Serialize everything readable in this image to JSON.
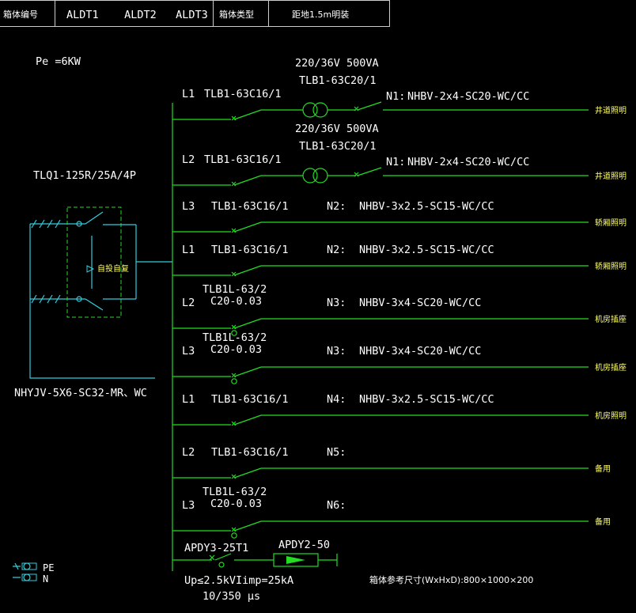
{
  "header": {
    "box_no_label": "箱体编号",
    "box_ids": "ALDT1    ALDT2   ALDT3",
    "box_type_label": "箱体类型",
    "box_type_value": "距地1.5m明装"
  },
  "panel": {
    "power": "Pe =6KW",
    "main_switch": "TLQ1-125R/25A/4P",
    "ats_label": "自投自复",
    "incoming_cable": "NHYJV-5X6-SC32-MR、WC"
  },
  "circuits": [
    {
      "phase": "L1",
      "breaker": "TLB1-63C16/1",
      "breaker2": "",
      "trafo_spec": "220/36V  500VA",
      "trafo_breaker": "TLB1-63C20/1",
      "circuit": "N1:",
      "cable": "NHBV-2x4-SC20-WC/CC",
      "load": "井道照明"
    },
    {
      "phase": "L2",
      "breaker": "TLB1-63C16/1",
      "breaker2": "",
      "trafo_spec": "220/36V  500VA",
      "trafo_breaker": "TLB1-63C20/1",
      "circuit": "N1:",
      "cable": "NHBV-2x4-SC20-WC/CC",
      "load": "井道照明"
    },
    {
      "phase": "L3",
      "breaker": "TLB1-63C16/1",
      "breaker2": "",
      "trafo_spec": "",
      "trafo_breaker": "",
      "circuit": "N2:",
      "cable": "NHBV-3x2.5-SC15-WC/CC",
      "load": "轿厢照明"
    },
    {
      "phase": "L1",
      "breaker": "TLB1-63C16/1",
      "breaker2": "",
      "trafo_spec": "",
      "trafo_breaker": "",
      "circuit": "N2:",
      "cable": "NHBV-3x2.5-SC15-WC/CC",
      "load": "轿厢照明"
    },
    {
      "phase": "L2",
      "breaker": "TLB1L-63/2",
      "breaker2": "C20-0.03",
      "trafo_spec": "",
      "trafo_breaker": "",
      "circuit": "N3:",
      "cable": "NHBV-3x4-SC20-WC/CC",
      "load": "机房插座"
    },
    {
      "phase": "L3",
      "breaker": "TLB1L-63/2",
      "breaker2": "C20-0.03",
      "trafo_spec": "",
      "trafo_breaker": "",
      "circuit": "N3:",
      "cable": "NHBV-3x4-SC20-WC/CC",
      "load": "机房插座"
    },
    {
      "phase": "L1",
      "breaker": "TLB1-63C16/1",
      "breaker2": "",
      "trafo_spec": "",
      "trafo_breaker": "",
      "circuit": "N4:",
      "cable": "NHBV-3x2.5-SC15-WC/CC",
      "load": "机房照明"
    },
    {
      "phase": "L2",
      "breaker": "TLB1-63C16/1",
      "breaker2": "",
      "trafo_spec": "",
      "trafo_breaker": "",
      "circuit": "N5:",
      "cable": "",
      "load": "备用"
    },
    {
      "phase": "L3",
      "breaker": "TLB1L-63/2",
      "breaker2": "C20-0.03",
      "trafo_spec": "",
      "trafo_breaker": "",
      "circuit": "N6:",
      "cable": "",
      "load": "备用"
    }
  ],
  "spd": {
    "breaker": "APDY3-25T1",
    "protector": "APDY2-50",
    "rating": "Up≤2.5kVIimp=25kA",
    "waveform": "10/350 μs"
  },
  "legend": {
    "pe": "PE",
    "n": "N"
  },
  "box_size": "箱体参考尺寸(WxHxD):800×1000×200"
}
